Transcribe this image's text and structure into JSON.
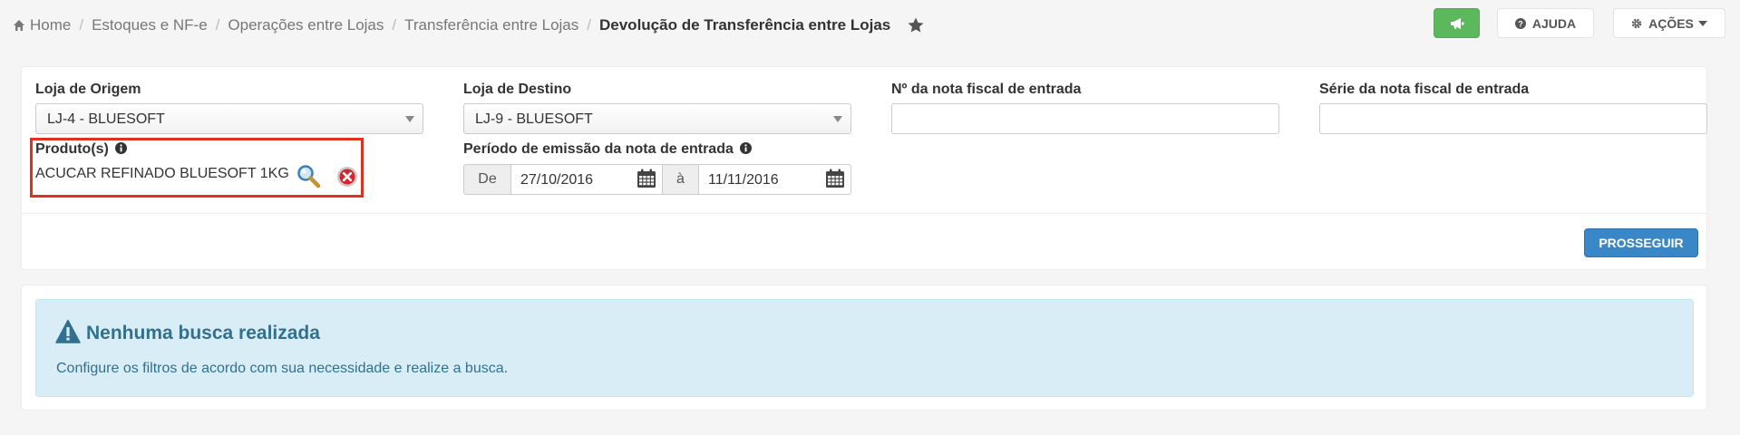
{
  "breadcrumb": {
    "items": [
      "Home",
      "Estoques e NF-e",
      "Operações entre Lojas",
      "Transferência entre Lojas"
    ],
    "current": "Devolução de Transferência entre Lojas",
    "separator": "/"
  },
  "header_buttons": {
    "announce_icon": "bullhorn-icon",
    "help_label": "AJUDA",
    "actions_label": "AÇÕES"
  },
  "filters": {
    "origin": {
      "label": "Loja de Origem",
      "value": "LJ-4 - BLUESOFT"
    },
    "destination": {
      "label": "Loja de Destino",
      "value": "LJ-9 - BLUESOFT"
    },
    "invoice_number": {
      "label": "Nº da nota fiscal de entrada",
      "value": ""
    },
    "invoice_series": {
      "label": "Série da nota fiscal de entrada",
      "value": ""
    },
    "products": {
      "label": "Produto(s)",
      "selected": "ACUCAR REFINADO BLUESOFT 1KG"
    },
    "period": {
      "label": "Período de emissão da nota de entrada",
      "from_label": "De",
      "from_value": "27/10/2016",
      "to_label": "à",
      "to_value": "11/11/2016"
    }
  },
  "proceed_label": "PROSSEGUIR",
  "alert": {
    "title": "Nenhuma busca realizada",
    "text": "Configure os filtros de acordo com sua necessidade e realize a busca."
  },
  "colors": {
    "success": "#5cb85c",
    "primary": "#3a87c8",
    "info_bg": "#d9edf7",
    "info_text": "#31708f",
    "highlight": "#e0311f"
  }
}
